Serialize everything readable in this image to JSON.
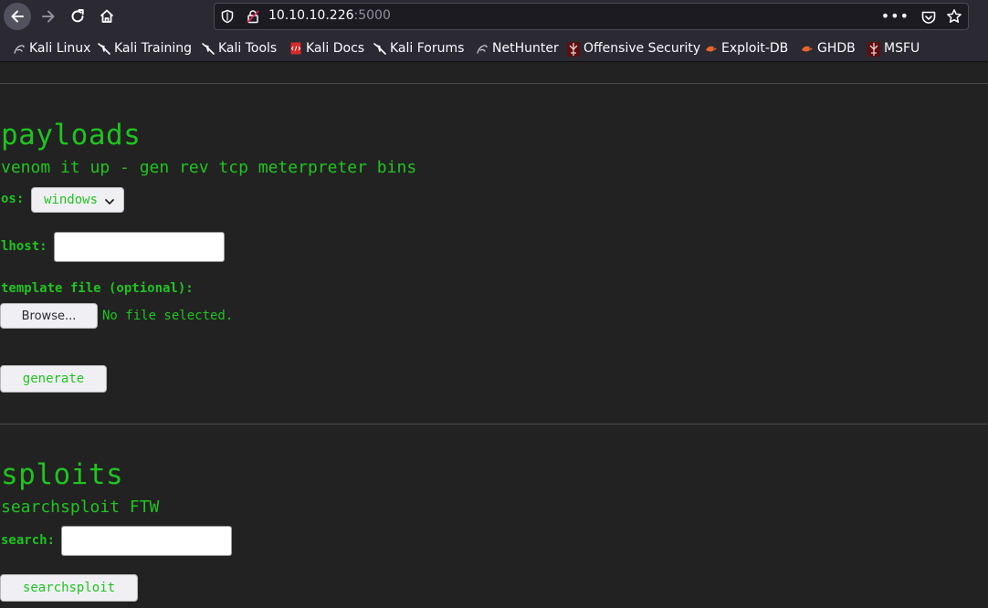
{
  "browser": {
    "url_host": "10.10.10.226",
    "url_port": ":5000",
    "more_label": "•••",
    "accent": "#52525e"
  },
  "bookmarks": [
    {
      "label": "Kali Linux",
      "icon": "kali-dragon-icon"
    },
    {
      "label": "Kali Training",
      "icon": "kali-dragon-icon"
    },
    {
      "label": "Kali Tools",
      "icon": "kali-dragon-icon"
    },
    {
      "label": "Kali Docs",
      "icon": "kali-docs-icon"
    },
    {
      "label": "Kali Forums",
      "icon": "kali-dragon-icon"
    },
    {
      "label": "NetHunter",
      "icon": "nethunter-icon"
    },
    {
      "label": "Offensive Security",
      "icon": "offsec-icon"
    },
    {
      "label": "Exploit-DB",
      "icon": "exploitdb-icon"
    },
    {
      "label": "GHDB",
      "icon": "ghdb-icon"
    },
    {
      "label": "MSFU",
      "icon": "msfu-icon"
    }
  ],
  "payloads": {
    "title": "payloads",
    "subtitle": "venom it up - gen rev tcp meterpreter bins",
    "os_label": "os:",
    "os_selected": "windows",
    "lhost_label": "lhost:",
    "lhost_value": "",
    "template_label": "template file (optional):",
    "browse_label": "Browse...",
    "no_file_text": "No file selected.",
    "generate_label": "generate"
  },
  "sploits": {
    "title": "sploits",
    "subtitle": "searchsploit FTW",
    "search_label": "search:",
    "search_value": "",
    "button_label": "searchsploit"
  },
  "colors": {
    "text_green": "#1fc41f",
    "page_bg": "#222222",
    "chrome_bg": "#2b2a33"
  }
}
